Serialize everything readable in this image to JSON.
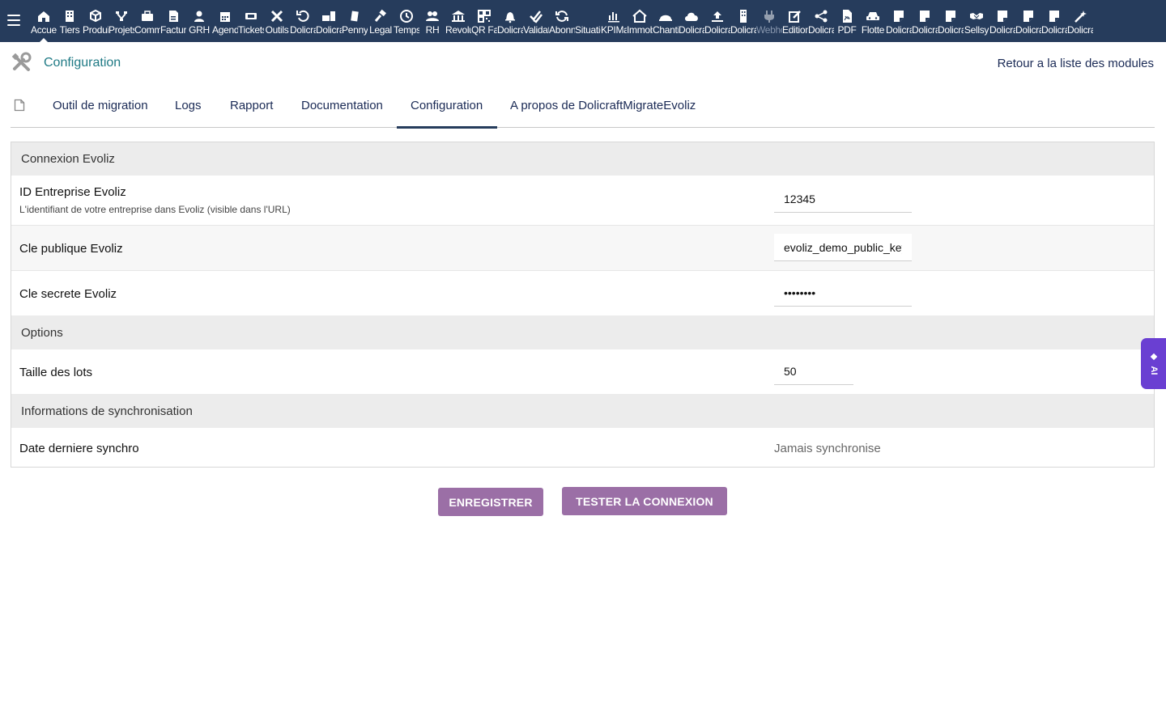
{
  "topbar": {
    "modules": [
      {
        "label": "Accueil",
        "icon": "home-icon"
      },
      {
        "label": "Tiers",
        "icon": "building-icon"
      },
      {
        "label": "Produits",
        "icon": "cube-icon"
      },
      {
        "label": "Projets",
        "icon": "project-icon"
      },
      {
        "label": "Commercial",
        "icon": "briefcase-icon"
      },
      {
        "label": "Facturation",
        "icon": "invoice-icon"
      },
      {
        "label": "GRH",
        "icon": "user-icon"
      },
      {
        "label": "Agenda",
        "icon": "calendar-icon"
      },
      {
        "label": "Tickets",
        "icon": "ticket-icon"
      },
      {
        "label": "Outils",
        "icon": "tools-icon"
      },
      {
        "label": "Dolicraft",
        "icon": "undo-icon"
      },
      {
        "label": "Dolicraft",
        "icon": "briefcase-doc-icon"
      },
      {
        "label": "Pennylane",
        "icon": "doc-icon"
      },
      {
        "label": "Legal",
        "icon": "gavel-icon"
      },
      {
        "label": "Temps",
        "icon": "clock-icon"
      },
      {
        "label": "RH",
        "icon": "users-icon"
      },
      {
        "label": "Revolut",
        "icon": "bank-icon"
      },
      {
        "label": "QR Facture",
        "icon": "qrcode-icon"
      },
      {
        "label": "Dolicraft",
        "icon": "bell-icon"
      },
      {
        "label": "Validation",
        "icon": "double-check-icon"
      },
      {
        "label": "Abonnements",
        "icon": "refresh-icon"
      },
      {
        "label": "Situation",
        "icon": "situation-icon"
      },
      {
        "label": "KPIMaster",
        "icon": "bar-chart-icon"
      },
      {
        "label": "Immobilier",
        "icon": "house-icon"
      },
      {
        "label": "Chantier",
        "icon": "hardhat-icon"
      },
      {
        "label": "Dolicraft",
        "icon": "cloud-icon"
      },
      {
        "label": "Dolicraft",
        "icon": "upload-icon"
      },
      {
        "label": "Dolicraft",
        "icon": "tower-icon"
      },
      {
        "label": "Webhooks",
        "icon": "plug-icon",
        "dim": true
      },
      {
        "label": "Edition",
        "icon": "edit-icon"
      },
      {
        "label": "Dolicraft",
        "icon": "share-icon"
      },
      {
        "label": "PDF",
        "icon": "pdf-icon"
      },
      {
        "label": "Flotte",
        "icon": "car-icon"
      },
      {
        "label": "Dolicraft",
        "icon": "note-icon"
      },
      {
        "label": "Dolicraft",
        "icon": "note-icon"
      },
      {
        "label": "Dolicraft",
        "icon": "note-icon"
      },
      {
        "label": "Sellsy",
        "icon": "handshake-icon"
      },
      {
        "label": "Dolicraft",
        "icon": "note-icon"
      },
      {
        "label": "Dolicraft",
        "icon": "note-icon"
      },
      {
        "label": "Dolicraft",
        "icon": "note-icon"
      },
      {
        "label": "Dolicraft",
        "icon": "magic-wand-icon"
      }
    ]
  },
  "header": {
    "title": "Configuration",
    "back_link": "Retour a la liste des modules"
  },
  "tabs": [
    {
      "label": "Outil de migration"
    },
    {
      "label": "Logs"
    },
    {
      "label": "Rapport"
    },
    {
      "label": "Documentation"
    },
    {
      "label": "Configuration",
      "active": true
    },
    {
      "label": "A propos de DolicraftMigrateEvoliz"
    }
  ],
  "form": {
    "section_connexion": "Connexion Evoliz",
    "company_id": {
      "label": "ID Entreprise Evoliz",
      "description": "L'identifiant de votre entreprise dans Evoliz (visible dans l'URL)",
      "value": "12345"
    },
    "public_key": {
      "label": "Cle publique Evoliz",
      "value": "evoliz_demo_public_key"
    },
    "secret_key": {
      "label": "Cle secrete Evoliz",
      "value": "secret12"
    },
    "section_options": "Options",
    "batch_size": {
      "label": "Taille des lots",
      "value": "50"
    },
    "section_sync": "Informations de synchronisation",
    "last_sync": {
      "label": "Date derniere synchro",
      "value": "Jamais synchronise"
    }
  },
  "buttons": {
    "save": "ENREGISTRER",
    "test": "TESTER LA CONNEXION"
  },
  "ai_tab": {
    "label": "AI"
  },
  "colors": {
    "topbar": "#263c5c",
    "button": "#9b6fa6",
    "ai_tab": "#6a3fd2",
    "title": "#1f7a85"
  }
}
